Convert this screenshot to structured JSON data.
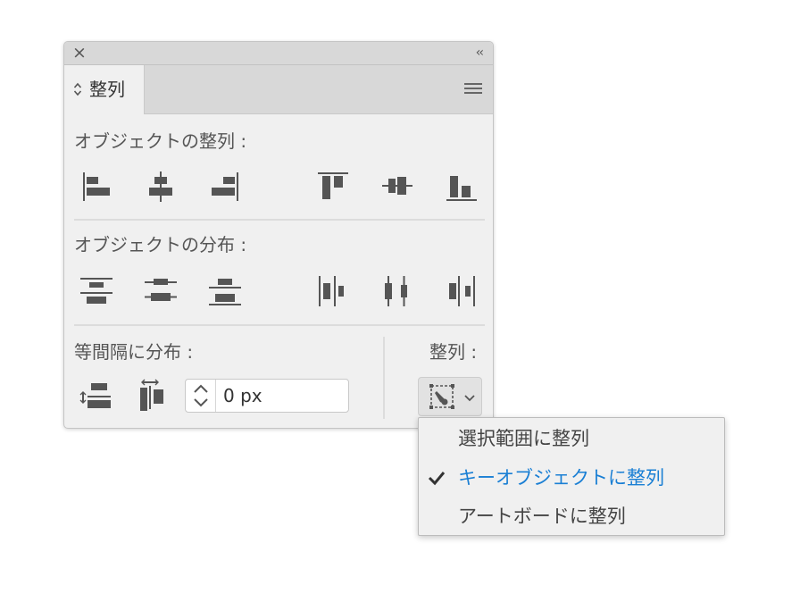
{
  "titlebar": {
    "close_icon": "×",
    "collapse_icon": "‹‹"
  },
  "tab": {
    "label": "整列"
  },
  "align_objects": {
    "label": "オブジェクトの整列 :"
  },
  "distribute_objects": {
    "label": "オブジェクトの分布 :"
  },
  "distribute_spacing": {
    "label": "等間隔に分布 :",
    "spacing_value": "0 px"
  },
  "align_to": {
    "label": "整列 :"
  },
  "dropdown": {
    "items": [
      {
        "label": "選択範囲に整列",
        "selected": false
      },
      {
        "label": "キーオブジェクトに整列",
        "selected": true
      },
      {
        "label": "アートボードに整列",
        "selected": false
      }
    ]
  },
  "colors": {
    "icon": "#555555",
    "selected_text": "#1a7fd4",
    "panel_bg": "#f0f0f0",
    "header_bg": "#d8d8d8"
  },
  "icons": {
    "tab_arrows": "up-down-arrows-icon",
    "menu": "hamburger-menu-icon",
    "align_to_menu": "align-to-key-object-icon",
    "check": "checkmark-icon"
  }
}
